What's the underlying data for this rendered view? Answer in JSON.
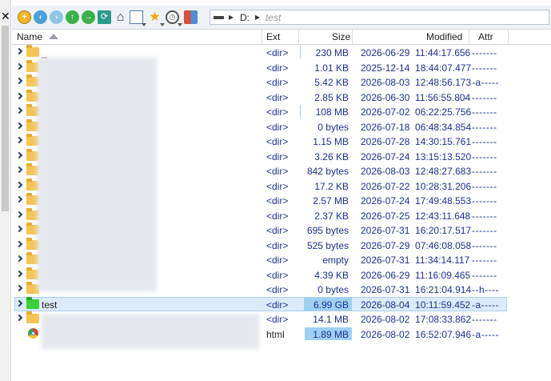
{
  "toolbar": {
    "buttons": [
      "add-icon",
      "back-icon",
      "forward-icon",
      "up-icon",
      "next-icon",
      "refresh-icon",
      "home-icon",
      "view-icon",
      "favorites-icon",
      "history-icon",
      "settings-icon"
    ],
    "address": {
      "drive": "D:",
      "folder": "test"
    }
  },
  "columns": {
    "name": "Name",
    "ext": "Ext",
    "size": "Size",
    "modified": "Modified",
    "attr": "Attr"
  },
  "rows": [
    {
      "name": "_",
      "ext": "<dir>",
      "size": "230 MB",
      "modified": "2026-06-29  11:44:17.656",
      "attr": "-------",
      "bar": 0
    },
    {
      "name": "",
      "ext": "<dir>",
      "size": "1.01 KB",
      "modified": "2025-12-14  18:44:07.477",
      "attr": "-------",
      "bar": 0
    },
    {
      "name": "",
      "ext": "<dir>",
      "size": "5.42 KB",
      "modified": "2026-08-03  12:48:56.173",
      "attr": "-a-----",
      "bar": 0
    },
    {
      "name": "",
      "ext": "<dir>",
      "size": "2.85 KB",
      "modified": "2026-06-30  11:56:55.804",
      "attr": "-------",
      "bar": 0
    },
    {
      "name": "",
      "ext": "<dir>",
      "size": "108 MB",
      "modified": "2026-07-02  06:22:25.756",
      "attr": "-------",
      "bar": 0
    },
    {
      "name": "",
      "ext": "<dir>",
      "size": "0 bytes",
      "modified": "2026-07-18  06:48:34.854",
      "attr": "-------",
      "bar": 0
    },
    {
      "name": "",
      "ext": "<dir>",
      "size": "1.15 MB",
      "modified": "2026-07-28  14:30:15.761",
      "attr": "-------",
      "bar": 0
    },
    {
      "name": "",
      "ext": "<dir>",
      "size": "3.26 KB",
      "modified": "2026-07-24  13:15:13.520",
      "attr": "-------",
      "bar": 0
    },
    {
      "name": "",
      "ext": "<dir>",
      "size": "842 bytes",
      "modified": "2026-08-03  12:48:27.683",
      "attr": "-------",
      "bar": 0
    },
    {
      "name": "",
      "ext": "<dir>",
      "size": "17.2 KB",
      "modified": "2026-07-22  10:28:31.206",
      "attr": "-------",
      "bar": 0
    },
    {
      "name": "",
      "ext": "<dir>",
      "size": "2.57 MB",
      "modified": "2026-07-24  17:49:48.553",
      "attr": "-------",
      "bar": 0
    },
    {
      "name": "",
      "ext": "<dir>",
      "size": "2.37 KB",
      "modified": "2026-07-25  12:43:11.648",
      "attr": "-------",
      "bar": 0
    },
    {
      "name": "",
      "ext": "<dir>",
      "size": "695 bytes",
      "modified": "2026-07-31  16:20:17.517",
      "attr": "-------",
      "bar": 0
    },
    {
      "name": "",
      "ext": "<dir>",
      "size": "525 bytes",
      "modified": "2026-07-29  07:46:08.058",
      "attr": "-------",
      "bar": 0
    },
    {
      "name": "",
      "ext": "<dir>",
      "size": "empty",
      "modified": "2026-07-31  11:34:14.117",
      "attr": "-------",
      "bar": 0
    },
    {
      "name": "",
      "ext": "<dir>",
      "size": "4.39 KB",
      "modified": "2026-06-29  11:16:09.465",
      "attr": "-------",
      "bar": 0
    },
    {
      "name": "",
      "ext": "<dir>",
      "size": "0 bytes",
      "modified": "2026-07-31  16:21:04.914",
      "attr": "--h----",
      "bar": 0
    },
    {
      "name": "test",
      "ext": "<dir>",
      "size": "6.99 GB",
      "modified": "2026-08-04  10:11:59.452",
      "attr": "-a-----",
      "bar": 0.9,
      "selected": true,
      "folder_color": "#3ad13a"
    },
    {
      "name": "",
      "ext": "<dir>",
      "size": "14.1 MB",
      "modified": "2026-08-02  17:08:33.862",
      "attr": "-------",
      "bar": 0
    },
    {
      "name": "",
      "ext": "html",
      "size": "1.89 MB",
      "modified": "2026-08-02  16:52:07.946",
      "attr": "-a-----",
      "bar": 0.88,
      "file": true
    }
  ],
  "colors": {
    "folder": "#f6c451",
    "accent_text": "#1c2f91",
    "selection": "#dcebfa",
    "size_bar": "#9fd0f4"
  }
}
